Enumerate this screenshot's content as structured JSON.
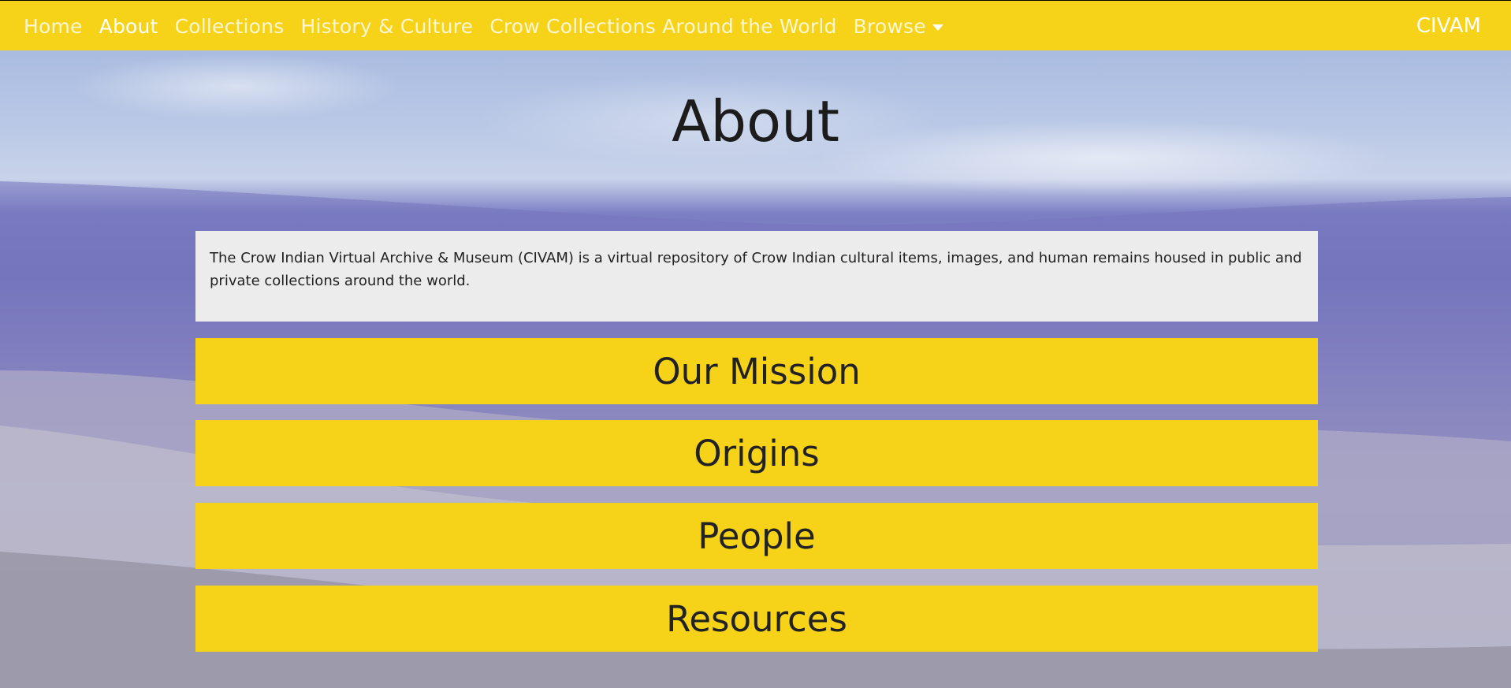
{
  "colors": {
    "brand_yellow": "#f6d319",
    "nav_text": "#ffffff",
    "intro_bg": "#ececec",
    "heading_text": "#1c1c1c"
  },
  "nav": {
    "links": [
      {
        "label": "Home"
      },
      {
        "label": "About"
      },
      {
        "label": "Collections"
      },
      {
        "label": "History & Culture"
      },
      {
        "label": "Crow Collections Around the World"
      },
      {
        "label": "Browse"
      }
    ],
    "browse_icon": "caret-down-icon",
    "brand": "CIVAM"
  },
  "page": {
    "title": "About",
    "intro": "The Crow Indian Virtual Archive & Museum (CIVAM) is a virtual repository of Crow Indian cultural items, images, and human remains housed in public and private collections around the world."
  },
  "sections": [
    {
      "label": "Our Mission"
    },
    {
      "label": "Origins"
    },
    {
      "label": "People"
    },
    {
      "label": "Resources"
    }
  ]
}
